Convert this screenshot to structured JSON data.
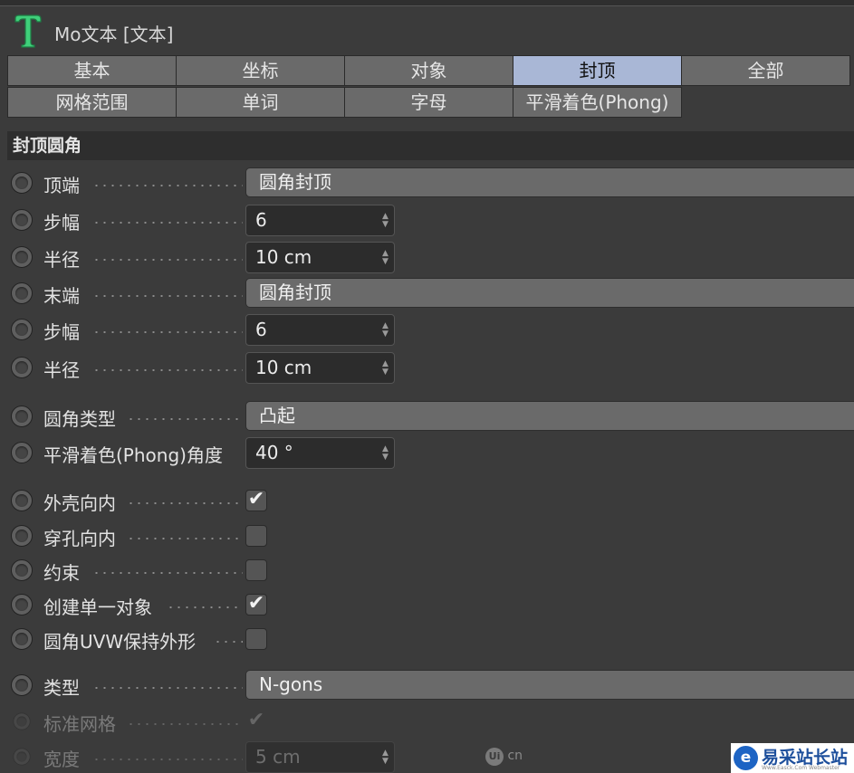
{
  "header": {
    "title": "Mo文本 [文本]"
  },
  "tabs": [
    {
      "label": "基本",
      "active": false
    },
    {
      "label": "坐标",
      "active": false
    },
    {
      "label": "对象",
      "active": false
    },
    {
      "label": "封顶",
      "active": true
    },
    {
      "label": "全部",
      "active": false
    },
    {
      "label": "网格范围",
      "active": false
    },
    {
      "label": "单词",
      "active": false
    },
    {
      "label": "字母",
      "active": false
    },
    {
      "label": "平滑着色(Phong)",
      "active": false
    }
  ],
  "section": {
    "title": "封顶圆角"
  },
  "rows": [
    {
      "label": "顶端",
      "control": "dropdown",
      "value": "圆角封顶"
    },
    {
      "label": "步幅",
      "control": "spinner",
      "value": "6"
    },
    {
      "label": "半径",
      "control": "spinner",
      "value": "10 cm"
    },
    {
      "label": "末端",
      "control": "dropdown",
      "value": "圆角封顶"
    },
    {
      "label": "步幅",
      "control": "spinner",
      "value": "6"
    },
    {
      "label": "半径",
      "control": "spinner",
      "value": "10 cm"
    },
    {
      "label": "圆角类型",
      "control": "dropdown",
      "value": "凸起"
    },
    {
      "label": "平滑着色(Phong)角度",
      "control": "spinner",
      "value": "40 °"
    },
    {
      "label": "外壳向内",
      "control": "checkbox",
      "checked": true
    },
    {
      "label": "穿孔向内",
      "control": "checkbox",
      "checked": false
    },
    {
      "label": "约束",
      "control": "checkbox",
      "checked": false
    },
    {
      "label": "创建单一对象",
      "control": "checkbox",
      "checked": true
    },
    {
      "label": "圆角UVW保持外形",
      "control": "checkbox",
      "checked": false
    },
    {
      "label": "类型",
      "control": "dropdown",
      "value": "N-gons"
    },
    {
      "label": "标准网格",
      "control": "checkbox",
      "checked": true,
      "disabled": true
    },
    {
      "label": "宽度",
      "control": "spinner",
      "value": "5 cm",
      "disabled": true
    }
  ],
  "watermarks": {
    "ui_cn": "cn",
    "ui_cn_glyph": "Ui",
    "brand_name": "易采站长站",
    "brand_sub": "Www.Easck.Com Webmaster",
    "brand_glyph": "e"
  },
  "colors": {
    "active_tab": "#a9b7d6",
    "panel_bg": "#3b3b3b",
    "icon_green": "#3fcf7a"
  }
}
